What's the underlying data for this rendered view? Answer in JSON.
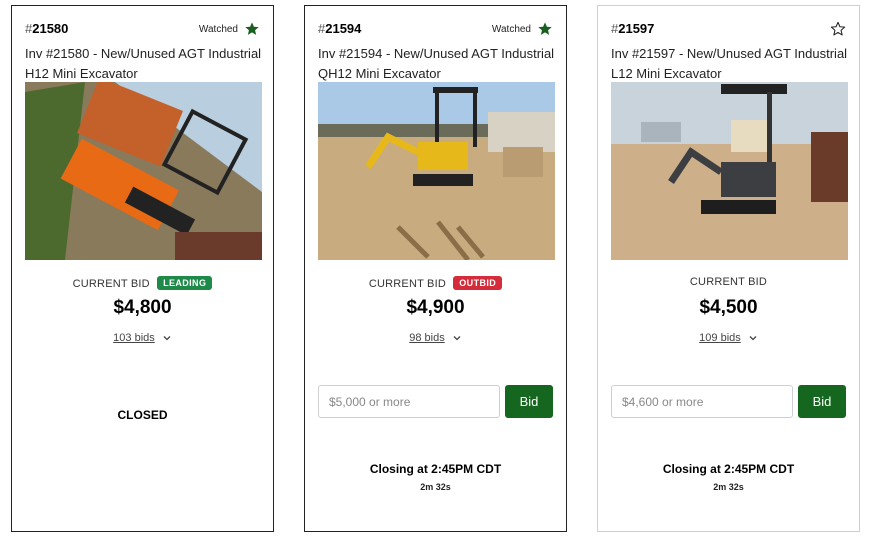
{
  "cards": [
    {
      "lot_hash": "#",
      "lot_number": "21580",
      "watched": true,
      "watch_label": "Watched",
      "title": "Inv #21580 - New/Unused AGT Industrial H12 Mini Excavator",
      "image_desc": "Orange mini excavator",
      "current_bid_label": "CURRENT BID",
      "status_badge": "LEADING",
      "amount": "$4,800",
      "bids_link": "103 bids",
      "closed_label": "CLOSED"
    },
    {
      "lot_hash": "#",
      "lot_number": "21594",
      "watched": true,
      "watch_label": "Watched",
      "title": "Inv #21594 - New/Unused AGT Industrial QH12 Mini Excavator",
      "image_desc": "Yellow mini excavator",
      "current_bid_label": "CURRENT BID",
      "status_badge": "OUTBID",
      "amount": "$4,900",
      "bids_link": "98 bids",
      "bid_placeholder": "$5,000 or more",
      "bid_button": "Bid",
      "closing_label": "Closing at 2:45PM CDT",
      "timer": "2m 32s"
    },
    {
      "lot_hash": "#",
      "lot_number": "21597",
      "watched": false,
      "title": "Inv #21597 - New/Unused AGT Industrial L12 Mini Excavator",
      "image_desc": "Gray mini excavator with canopy",
      "current_bid_label": "CURRENT BID",
      "amount": "$4,500",
      "bids_link": "109 bids",
      "bid_placeholder": "$4,600 or more",
      "bid_button": "Bid",
      "closing_label": "Closing at 2:45PM CDT",
      "timer": "2m 32s"
    }
  ],
  "colors": {
    "watched_star": "#1a5e20",
    "leading_badge": "#1e8a4a",
    "outbid_badge": "#d42c3a",
    "bid_button": "#15661e"
  }
}
